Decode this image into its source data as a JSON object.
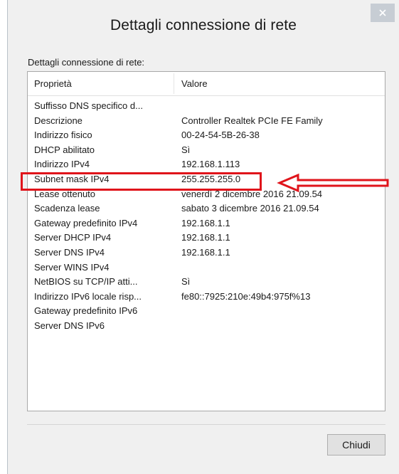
{
  "window": {
    "title": "Dettagli connessione di rete"
  },
  "group_label": "Dettagli connessione di rete:",
  "listview": {
    "headers": {
      "property": "Proprietà",
      "value": "Valore"
    },
    "rows": [
      {
        "property": "Suffisso DNS specifico d...",
        "value": ""
      },
      {
        "property": "Descrizione",
        "value": "Controller Realtek PCIe FE Family"
      },
      {
        "property": "Indirizzo fisico",
        "value": "00-24-54-5B-26-38"
      },
      {
        "property": "DHCP abilitato",
        "value": "Sì"
      },
      {
        "property": "Indirizzo IPv4",
        "value": "192.168.1.113"
      },
      {
        "property": "Subnet mask IPv4",
        "value": "255.255.255.0"
      },
      {
        "property": "Lease ottenuto",
        "value": "venerdì 2 dicembre 2016 21.09.54"
      },
      {
        "property": "Scadenza lease",
        "value": "sabato 3 dicembre 2016 21.09.54"
      },
      {
        "property": "Gateway predefinito IPv4",
        "value": "192.168.1.1"
      },
      {
        "property": "Server DHCP IPv4",
        "value": "192.168.1.1"
      },
      {
        "property": "Server DNS IPv4",
        "value": "192.168.1.1"
      },
      {
        "property": "Server WINS IPv4",
        "value": ""
      },
      {
        "property": "NetBIOS su TCP/IP atti...",
        "value": "Sì"
      },
      {
        "property": "Indirizzo IPv6 locale risp...",
        "value": "fe80::7925:210e:49b4:975f%13"
      },
      {
        "property": "Gateway predefinito IPv6",
        "value": ""
      },
      {
        "property": "Server DNS IPv6",
        "value": ""
      }
    ]
  },
  "buttons": {
    "close_label": "Chiudi"
  },
  "annotation": {
    "color": "#e0141b",
    "highlighted_row": "Indirizzo IPv4"
  },
  "icons": {
    "title_close": "close-icon",
    "annotation_arrow": "arrow-left-icon"
  },
  "colors": {
    "window_bg": "#f0f0f0",
    "title_close_bg": "#c7cdd4",
    "list_bg": "#ffffff"
  }
}
